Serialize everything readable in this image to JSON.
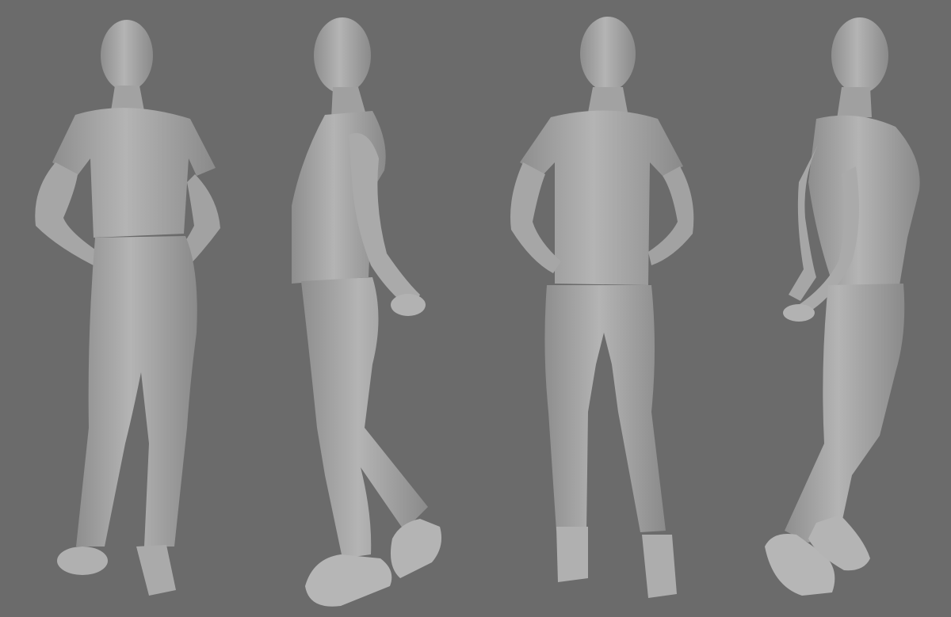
{
  "scene": {
    "background_color": "#6b6b6b",
    "model_color": "#a8a8a8",
    "model_shadow_color": "#8a8a8a",
    "model_highlight_color": "#c2c2c2",
    "views": [
      {
        "id": "back",
        "icon": "mannequin-back-view"
      },
      {
        "id": "side-left",
        "icon": "mannequin-side-view"
      },
      {
        "id": "front",
        "icon": "mannequin-front-view"
      },
      {
        "id": "side-right",
        "icon": "mannequin-side-view"
      }
    ]
  }
}
